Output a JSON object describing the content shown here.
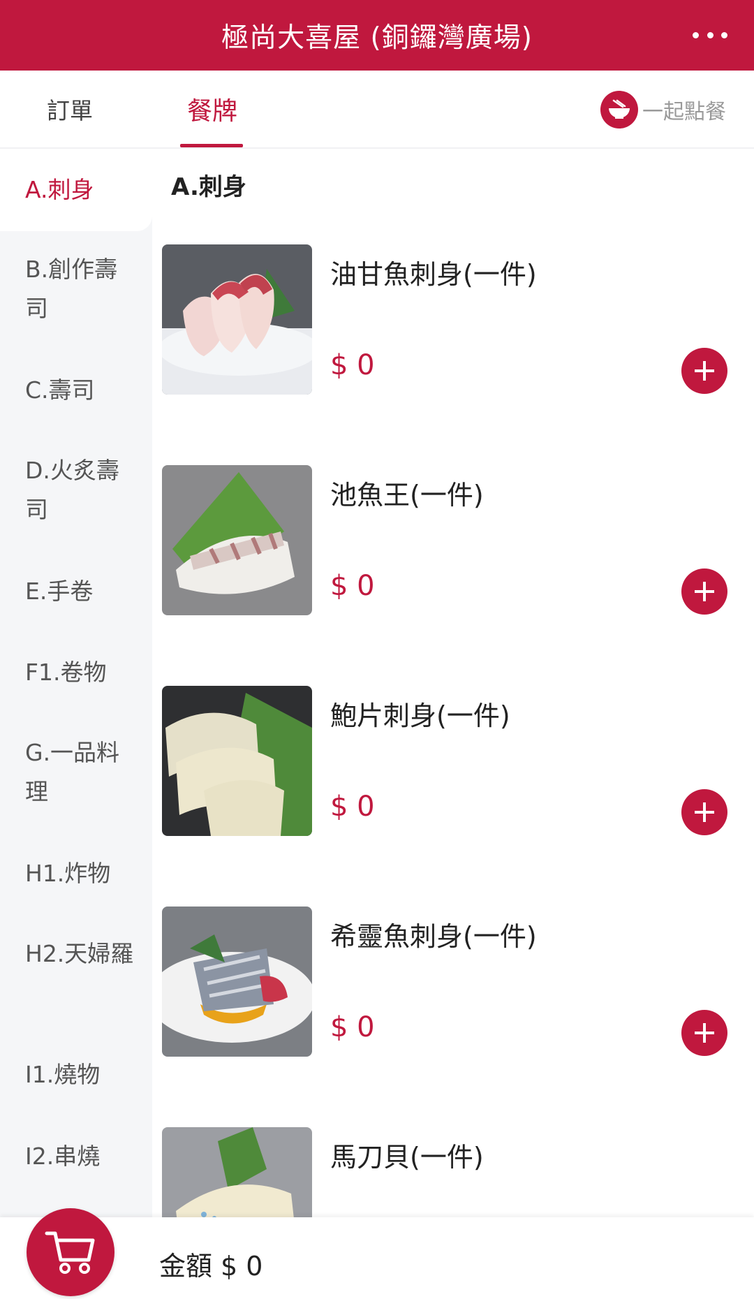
{
  "header": {
    "title": "極尚大喜屋 (銅鑼灣廣場)",
    "more_icon": "more-horizontal-icon"
  },
  "tabs": {
    "orders_label": "訂單",
    "menu_label": "餐牌",
    "group_order_label": "一起點餐",
    "group_order_icon": "bowl-icon"
  },
  "sidebar": {
    "items": [
      {
        "label": "A.刺身",
        "active": true
      },
      {
        "label": "B.創作壽司"
      },
      {
        "label": "C.壽司"
      },
      {
        "label": "D.火炙壽司"
      },
      {
        "label": "E.手卷"
      },
      {
        "label": "F1.卷物"
      },
      {
        "label": "G.一品料理"
      },
      {
        "label": "H1.炸物"
      },
      {
        "label": "H2.天婦羅"
      },
      {
        "label": "I1.燒物"
      },
      {
        "label": "I2.串燒"
      }
    ]
  },
  "section": {
    "title": "A.刺身"
  },
  "items": [
    {
      "name": "油甘魚刺身(一件)",
      "price": "$ 0"
    },
    {
      "name": "池魚王(一件)",
      "price": "$ 0"
    },
    {
      "name": "鮑片刺身(一件)",
      "price": "$ 0"
    },
    {
      "name": "希靈魚刺身(一件)",
      "price": "$ 0"
    },
    {
      "name": "馬刀貝(一件)",
      "price": ""
    }
  ],
  "footer": {
    "total_label": "金額",
    "total_value": "$ 0",
    "cart_icon": "cart-icon"
  },
  "colors": {
    "primary": "#C0183E",
    "sidebar_bg": "#f5f6f8"
  }
}
